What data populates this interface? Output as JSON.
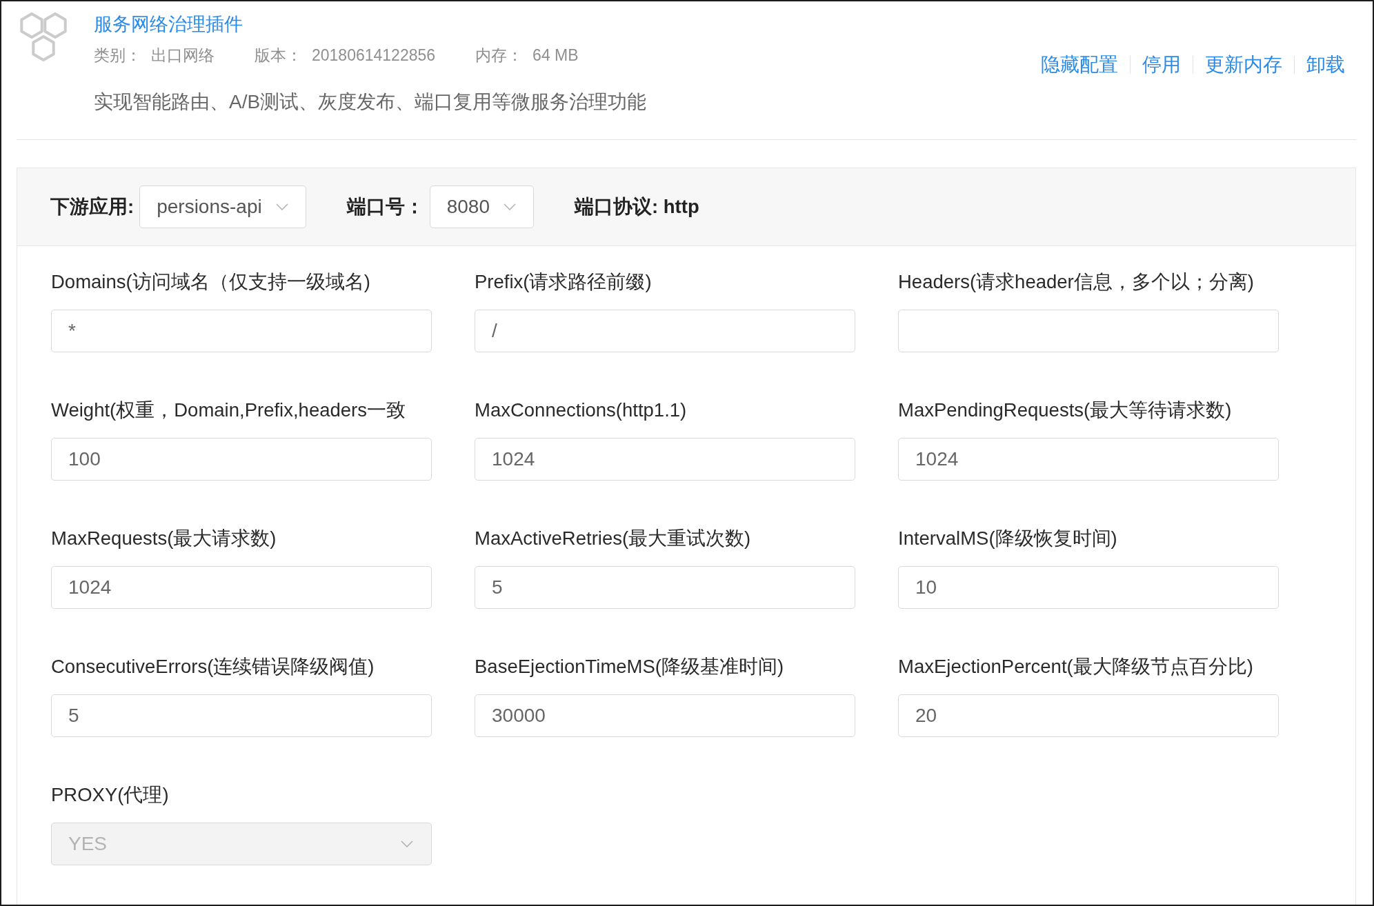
{
  "plugin": {
    "title": "服务网络治理插件",
    "meta": [
      {
        "label": "类别：",
        "value": "出口网络"
      },
      {
        "label": "版本：",
        "value": "20180614122856"
      },
      {
        "label": "内存：",
        "value": "64 MB"
      }
    ],
    "description": "实现智能路由、A/B测试、灰度发布、端口复用等微服务治理功能",
    "actions": [
      "隐藏配置",
      "停用",
      "更新内存",
      "卸载"
    ]
  },
  "filters": [
    {
      "kind": "select",
      "label": "下游应用:",
      "value": "persions-api"
    },
    {
      "kind": "select",
      "label": "端口号：",
      "value": "8080"
    },
    {
      "kind": "text",
      "text": "端口协议: http"
    }
  ],
  "fields": [
    {
      "kind": "input",
      "label": "Domains(访问域名（仅支持一级域名)",
      "value": "*",
      "disabled": false
    },
    {
      "kind": "input",
      "label": "Prefix(请求路径前缀)",
      "value": "/",
      "disabled": false
    },
    {
      "kind": "input",
      "label": "Headers(请求header信息，多个以；分离)",
      "disabled": false
    },
    {
      "kind": "input",
      "label": "Weight(权重，Domain,Prefix,headers一致",
      "value": "100",
      "disabled": false
    },
    {
      "kind": "input",
      "label": "MaxConnections(http1.1)",
      "value": "1024",
      "disabled": false
    },
    {
      "kind": "input",
      "label": "MaxPendingRequests(最大等待请求数)",
      "value": "1024",
      "disabled": false
    },
    {
      "kind": "input",
      "label": "MaxRequests(最大请求数)",
      "value": "1024",
      "disabled": false
    },
    {
      "kind": "input",
      "label": "MaxActiveRetries(最大重试次数)",
      "value": "5",
      "disabled": false
    },
    {
      "kind": "input",
      "label": "IntervalMS(降级恢复时间)",
      "value": "10",
      "disabled": false
    },
    {
      "kind": "input",
      "label": "ConsecutiveErrors(连续错误降级阀值)",
      "value": "5",
      "disabled": false
    },
    {
      "kind": "input",
      "label": "BaseEjectionTimeMS(降级基准时间)",
      "value": "30000",
      "disabled": false
    },
    {
      "kind": "input",
      "label": "MaxEjectionPercent(最大降级节点百分比)",
      "value": "20",
      "disabled": false
    },
    {
      "kind": "select",
      "label": "PROXY(代理)",
      "value": "YES",
      "disabled": true
    }
  ]
}
